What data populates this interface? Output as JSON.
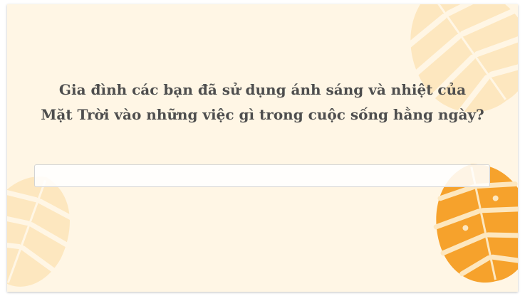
{
  "question": {
    "line1": "Gia đình các bạn đã sử dụng ánh sáng và nhiệt của",
    "line2": "Mặt Trời vào những việc gì trong cuộc sống hằng ngày?"
  },
  "answer": {
    "value": "",
    "placeholder": ""
  },
  "colors": {
    "background": "#fff6e5",
    "leaf_light": "#fde7bf",
    "leaf_orange": "#f6a22c",
    "text": "#4e4e4e"
  }
}
